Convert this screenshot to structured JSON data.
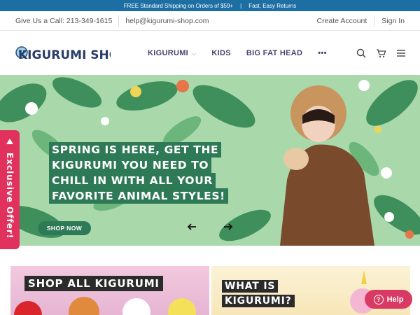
{
  "announcement": {
    "shipping": "FREE Standard Shipping on Orders of $59+",
    "separator": "|",
    "returns": "Fast, Easy Returns"
  },
  "utility": {
    "phone": "Give Us a Call: 213-349-1615",
    "email": "help@kigurumi-shop.com",
    "create_account": "Create Account",
    "sign_in": "Sign In"
  },
  "header": {
    "logo_text": "KIGURUMI SHOP",
    "nav": [
      {
        "label": "KIGURUMI",
        "has_dropdown": true
      },
      {
        "label": "KIDS"
      },
      {
        "label": "BIG FAT HEAD"
      },
      {
        "label": "•••"
      }
    ],
    "icons": [
      "search-icon",
      "cart-icon",
      "menu-icon"
    ]
  },
  "hero": {
    "headline": [
      "SPRING IS HERE, GET THE",
      "KIGURUMI YOU NEED TO",
      "CHILL IN WITH ALL YOUR",
      "FAVORITE ANIMAL STYLES!"
    ],
    "cta": "SHOP NOW",
    "prev_icon": "arrow-left-icon",
    "next_icon": "arrow-right-icon"
  },
  "exclusive_tab": "Exclusive Offer!",
  "tiles": [
    {
      "label": "SHOP ALL KIGURUMI"
    },
    {
      "label_lines": [
        "WHAT IS",
        "KIGURUMI?"
      ]
    }
  ],
  "help_button": "Help",
  "colors": {
    "announcement_bg": "#1d6fa3",
    "brand_green": "#2e7a57",
    "nav_text": "#4a3f6e",
    "accent_pink": "#e0325c"
  }
}
